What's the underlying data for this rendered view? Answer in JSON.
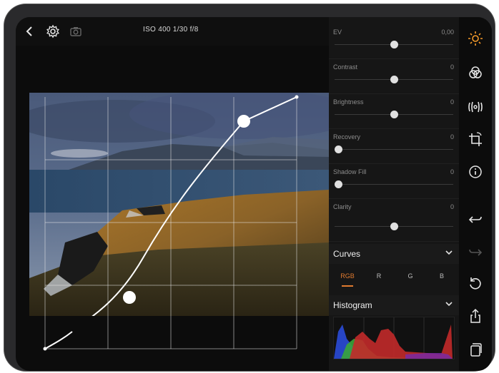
{
  "topbar": {
    "back_icon": "chevron-left-icon",
    "settings_icon": "gear-icon",
    "camera_icon": "camera-icon",
    "meta": "ISO 400  1/30  f/8"
  },
  "adjustments": [
    {
      "label": "EV",
      "value": "0,00",
      "level": 0.5
    },
    {
      "label": "Contrast",
      "value": "0",
      "level": 0.5
    },
    {
      "label": "Brightness",
      "value": "0",
      "level": 0.5
    },
    {
      "label": "Recovery",
      "value": "0",
      "level": 0.0
    },
    {
      "label": "Shadow Fill",
      "value": "0",
      "level": 0.0
    },
    {
      "label": "Clarity",
      "value": "0",
      "level": 0.5
    }
  ],
  "curves": {
    "title": "Curves",
    "channels": [
      "RGB",
      "R",
      "G",
      "B"
    ],
    "active_channel": "RGB"
  },
  "histogram": {
    "title": "Histogram"
  },
  "tools": [
    "sun-icon",
    "color-circles-icon",
    "vignette-icon",
    "crop-rotate-icon",
    "info-icon",
    "undo-icon",
    "redo-icon",
    "reset-icon",
    "share-icon",
    "copy-icon"
  ],
  "colors": {
    "accent": "#f39a2a",
    "channel_active": "#e07a2f"
  }
}
